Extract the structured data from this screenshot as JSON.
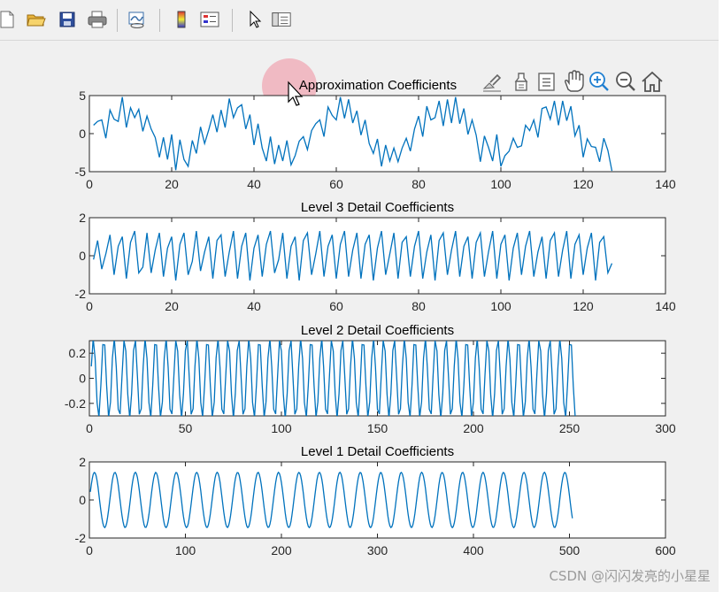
{
  "toolbar": {
    "icons": [
      "new-figure-icon",
      "open-file-icon",
      "save-icon",
      "print-icon",
      "link-plot-icon",
      "colorbar-icon",
      "legend-icon",
      "edit-plot-pointer-icon",
      "property-inspector-icon"
    ]
  },
  "axes_toolbar": {
    "icons": [
      "brush-icon",
      "data-cursor-icon",
      "datatips-icon",
      "pan-icon",
      "zoom-in-icon",
      "zoom-out-icon",
      "restore-view-icon"
    ]
  },
  "colors": {
    "line": "#0072bd",
    "axes_bg": "#ffffff",
    "figure_bg": "#f0f0f0",
    "highlight": "#ffc0cb"
  },
  "watermark": "CSDN @闪闪发亮的小星星",
  "chart_data": [
    {
      "type": "line",
      "title": "Approximation Coefficients",
      "xlabel": "",
      "ylabel": "",
      "xlim": [
        0,
        140
      ],
      "ylim": [
        -5,
        5
      ],
      "xticks": [
        "0",
        "20",
        "40",
        "60",
        "80",
        "100",
        "120",
        "140"
      ],
      "yticks": [
        "5",
        "0",
        "-5"
      ],
      "grid": false,
      "series": [
        {
          "x": [
            1,
            2,
            3,
            4,
            5,
            6,
            7,
            8,
            9,
            10,
            11,
            12,
            13,
            14,
            15,
            16,
            17,
            18,
            19,
            20,
            21,
            22,
            23,
            24,
            25,
            26,
            27,
            28,
            29,
            30,
            31,
            32,
            33,
            34,
            35,
            36,
            37,
            38,
            39,
            40,
            41,
            42,
            43,
            44,
            45,
            46,
            47,
            48,
            49,
            50,
            51,
            52,
            53,
            54,
            55,
            56,
            57,
            58,
            59,
            60,
            61,
            62,
            63,
            64,
            65,
            66,
            67,
            68,
            69,
            70,
            71,
            72,
            73,
            74,
            75,
            76,
            77,
            78,
            79,
            80,
            81,
            82,
            83,
            84,
            85,
            86,
            87,
            88,
            89,
            90,
            91,
            92,
            93,
            94,
            95,
            96,
            97,
            98,
            99,
            100,
            101,
            102,
            103,
            104,
            105,
            106,
            107,
            108,
            109,
            110,
            111,
            112,
            113,
            114,
            115,
            116,
            117,
            118,
            119,
            120,
            121,
            122,
            123,
            124,
            125,
            126,
            127
          ],
          "y": [
            1.1,
            1.6,
            1.8,
            -0.6,
            3.1,
            1.9,
            1.6,
            4.8,
            0.8,
            3.4,
            2.1,
            3.2,
            0.3,
            2.3,
            0.6,
            -0.5,
            -3.1,
            -0.5,
            -3.4,
            -0.1,
            -4.8,
            -0.8,
            -3.4,
            -4.3,
            -0.9,
            -2.6,
            0.9,
            -1.3,
            0.5,
            2.5,
            0.2,
            3.1,
            0.8,
            4.6,
            2.1,
            3.4,
            3.8,
            0.6,
            2.5,
            -1.5,
            1.3,
            -1.9,
            -3.6,
            -0.4,
            -4.0,
            -1.5,
            -3.6,
            -0.9,
            -4.1,
            -2.9,
            -1.0,
            -0.4,
            -2.1,
            0.4,
            1.3,
            1.8,
            -0.4,
            3.5,
            2.4,
            1.8,
            4.8,
            2.0,
            4.5,
            1.4,
            3.0,
            -0.2,
            1.8,
            -1.3,
            -2.6,
            -0.7,
            -4.3,
            -1.5,
            -3.6,
            -1.9,
            -3.7,
            -1.9,
            -0.6,
            -2.3,
            0.6,
            2.3,
            -0.4,
            3.6,
            1.8,
            2.1,
            4.3,
            1.0,
            4.5,
            1.4,
            4.8,
            1.3,
            3.3,
            -0.1,
            1.8,
            -0.2,
            -3.7,
            -0.3,
            -1.8,
            -3.6,
            -0.1,
            -4.3,
            -2.9,
            -2.3,
            -0.6,
            -1.8,
            -1.6,
            1.1,
            0.4,
            1.8,
            -0.5,
            3.3,
            3.5,
            1.9,
            4.3,
            1.1,
            4.3,
            1.7,
            3.6,
            -0.3,
            1.1,
            -3.1,
            -0.7,
            -1.7,
            -1.8,
            -3.7,
            -0.6,
            -2.2,
            -4.9
          ]
        }
      ]
    },
    {
      "type": "line",
      "title": "Level 3 Detail Coefficients",
      "xlabel": "",
      "ylabel": "",
      "xlim": [
        0,
        140
      ],
      "ylim": [
        -2,
        2
      ],
      "xticks": [
        "0",
        "20",
        "40",
        "60",
        "80",
        "100",
        "120",
        "140"
      ],
      "yticks": [
        "2",
        "0",
        "-2"
      ],
      "grid": false,
      "series": [
        {
          "x": [
            1,
            2,
            3,
            4,
            5,
            6,
            7,
            8,
            9,
            10,
            11,
            12,
            13,
            14,
            15,
            16,
            17,
            18,
            19,
            20,
            21,
            22,
            23,
            24,
            25,
            26,
            27,
            28,
            29,
            30,
            31,
            32,
            33,
            34,
            35,
            36,
            37,
            38,
            39,
            40,
            41,
            42,
            43,
            44,
            45,
            46,
            47,
            48,
            49,
            50,
            51,
            52,
            53,
            54,
            55,
            56,
            57,
            58,
            59,
            60,
            61,
            62,
            63,
            64,
            65,
            66,
            67,
            68,
            69,
            70,
            71,
            72,
            73,
            74,
            75,
            76,
            77,
            78,
            79,
            80,
            81,
            82,
            83,
            84,
            85,
            86,
            87,
            88,
            89,
            90,
            91,
            92,
            93,
            94,
            95,
            96,
            97,
            98,
            99,
            100,
            101,
            102,
            103,
            104,
            105,
            106,
            107,
            108,
            109,
            110,
            111,
            112,
            113,
            114,
            115,
            116,
            117,
            118,
            119,
            120,
            121,
            122,
            123,
            124,
            125,
            126,
            127
          ],
          "y": [
            -0.2,
            0.8,
            -0.7,
            0.1,
            1.1,
            -1.0,
            0.5,
            1.0,
            -1.2,
            0.7,
            1.3,
            -0.9,
            -0.6,
            1.2,
            -0.9,
            0.3,
            1.2,
            -1.1,
            0.4,
            1.0,
            -1.3,
            0.6,
            1.2,
            -1.0,
            -0.3,
            1.3,
            -0.8,
            0.2,
            1.0,
            -1.2,
            0.8,
            1.1,
            -1.1,
            0.2,
            1.3,
            -1.2,
            0.5,
            1.2,
            -1.3,
            0.4,
            1.1,
            -1.1,
            0.6,
            1.3,
            -0.9,
            -0.2,
            1.2,
            -1.2,
            0.5,
            1.0,
            -1.3,
            0.8,
            1.2,
            -1.0,
            0.1,
            1.3,
            -1.1,
            0.5,
            1.1,
            -1.2,
            0.6,
            1.3,
            -1.1,
            0.3,
            1.2,
            -1.2,
            0.6,
            1.1,
            -1.3,
            0.4,
            1.3,
            -1.0,
            0.1,
            1.2,
            -1.2,
            0.7,
            1.0,
            -1.1,
            0.5,
            1.3,
            -1.2,
            0.2,
            1.1,
            -1.3,
            0.8,
            1.2,
            -1.0,
            0.3,
            1.3,
            -1.1,
            0.5,
            1.0,
            -1.2,
            0.7,
            1.2,
            -1.1,
            0.2,
            1.3,
            -1.2,
            0.6,
            1.1,
            -1.3,
            0.4,
            1.2,
            -1.0,
            0.5,
            1.3,
            -1.1,
            0.2,
            1.0,
            -1.2,
            0.8,
            1.2,
            -1.1,
            0.3,
            1.3,
            -1.2,
            0.6,
            1.1,
            -1.0,
            0.4,
            1.2,
            -1.3,
            0.7,
            1.0,
            -0.9,
            -0.4
          ]
        }
      ]
    },
    {
      "type": "line",
      "title": "Level 2 Detail Coefficients",
      "xlabel": "",
      "ylabel": "",
      "xlim": [
        0,
        300
      ],
      "ylim": [
        -0.3,
        0.3
      ],
      "xticks": [
        "0",
        "50",
        "100",
        "150",
        "200",
        "250",
        "300"
      ],
      "yticks": [
        "0.2",
        "0",
        "-0.2"
      ],
      "grid": false,
      "series": [
        {
          "n_points": 253,
          "form": "sinusoid",
          "amplitude": 0.32,
          "period": 5.4,
          "x_range": [
            1,
            253
          ]
        }
      ]
    },
    {
      "type": "line",
      "title": "Level 1 Detail Coefficients",
      "xlabel": "",
      "ylabel": "",
      "xlim": [
        0,
        600
      ],
      "ylim": [
        -2,
        2
      ],
      "xticks": [
        "0",
        "100",
        "200",
        "300",
        "400",
        "500",
        "600"
      ],
      "yticks": [
        "2",
        "0",
        "-2"
      ],
      "grid": false,
      "series": [
        {
          "n_points": 503,
          "form": "sinusoid",
          "amplitude": 1.45,
          "period": 21.3,
          "x_range": [
            1,
            503
          ]
        }
      ]
    }
  ]
}
